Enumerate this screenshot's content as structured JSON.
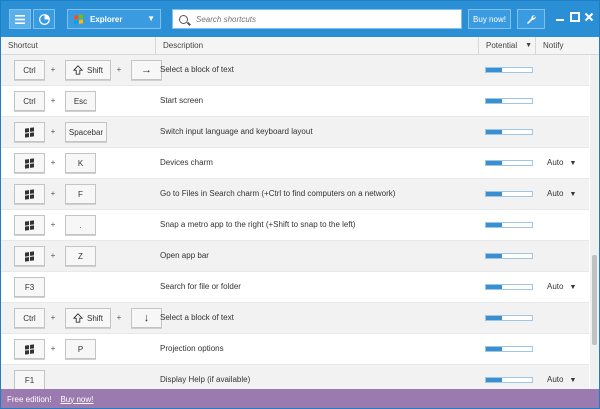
{
  "toolbar": {
    "category": "Explorer",
    "search_placeholder": "Search shortcuts",
    "buy_label": "Buy now!"
  },
  "columns": {
    "shortcut": "Shortcut",
    "description": "Description",
    "potential": "Potential",
    "notify": "Notify"
  },
  "rows": [
    {
      "keys": [
        "Ctrl",
        "Shift",
        "→"
      ],
      "description": "Select a block of text",
      "potential": 0.35,
      "notify": ""
    },
    {
      "keys": [
        "Ctrl",
        "Esc"
      ],
      "description": "Start screen",
      "potential": 0.35,
      "notify": ""
    },
    {
      "keys": [
        "Win",
        "Spacebar"
      ],
      "description": "Switch input language and keyboard layout",
      "potential": 0.35,
      "notify": ""
    },
    {
      "keys": [
        "Win",
        "K"
      ],
      "description": "Devices charm",
      "potential": 0.35,
      "notify": "Auto"
    },
    {
      "keys": [
        "Win",
        "F"
      ],
      "description": "Go to Files in Search charm (+Ctrl to find computers on a network)",
      "potential": 0.35,
      "notify": "Auto"
    },
    {
      "keys": [
        "Win",
        "."
      ],
      "description": "Snap a metro app to the right (+Shift to snap to the left)",
      "potential": 0.35,
      "notify": ""
    },
    {
      "keys": [
        "Win",
        "Z"
      ],
      "description": "Open app bar",
      "potential": 0.35,
      "notify": ""
    },
    {
      "keys": [
        "F3"
      ],
      "description": "Search for file or folder",
      "potential": 0.35,
      "notify": "Auto"
    },
    {
      "keys": [
        "Ctrl",
        "Shift",
        "↓"
      ],
      "description": "Select a block of text",
      "potential": 0.35,
      "notify": ""
    },
    {
      "keys": [
        "Win",
        "P"
      ],
      "description": "Projection options",
      "potential": 0.35,
      "notify": ""
    },
    {
      "keys": [
        "F1"
      ],
      "description": "Display Help (if available)",
      "potential": 0.35,
      "notify": "Auto"
    }
  ],
  "footer": {
    "edition": "Free edition!",
    "buy_link": "Buy now!"
  },
  "colors": {
    "titlebar": "#2b8fd6",
    "footer": "#9b7ab0",
    "bar_fill": "#3a8fd0"
  }
}
